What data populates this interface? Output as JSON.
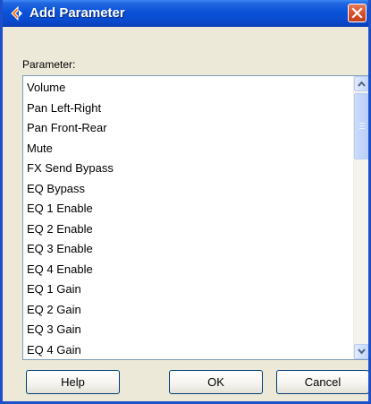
{
  "window": {
    "title": "Add Parameter"
  },
  "titlebar": {
    "icon": "cubase-logo-icon",
    "close_icon": "close-icon"
  },
  "accent_colors": {
    "titlebar": "#0a52d8",
    "close": "#d8502d",
    "dialog_bg": "#ece9d8"
  },
  "form": {
    "label": "Parameter:"
  },
  "parameter_list": {
    "items": [
      "Volume",
      "Pan Left-Right",
      "Pan Front-Rear",
      "Mute",
      "FX Send Bypass",
      "EQ Bypass",
      "EQ 1 Enable",
      "EQ 2 Enable",
      "EQ 3 Enable",
      "EQ 4 Enable",
      "EQ 1 Gain",
      "EQ 2 Gain",
      "EQ 3 Gain",
      "EQ 4 Gain"
    ]
  },
  "buttons": {
    "help": "Help",
    "ok": "OK",
    "cancel": "Cancel"
  }
}
